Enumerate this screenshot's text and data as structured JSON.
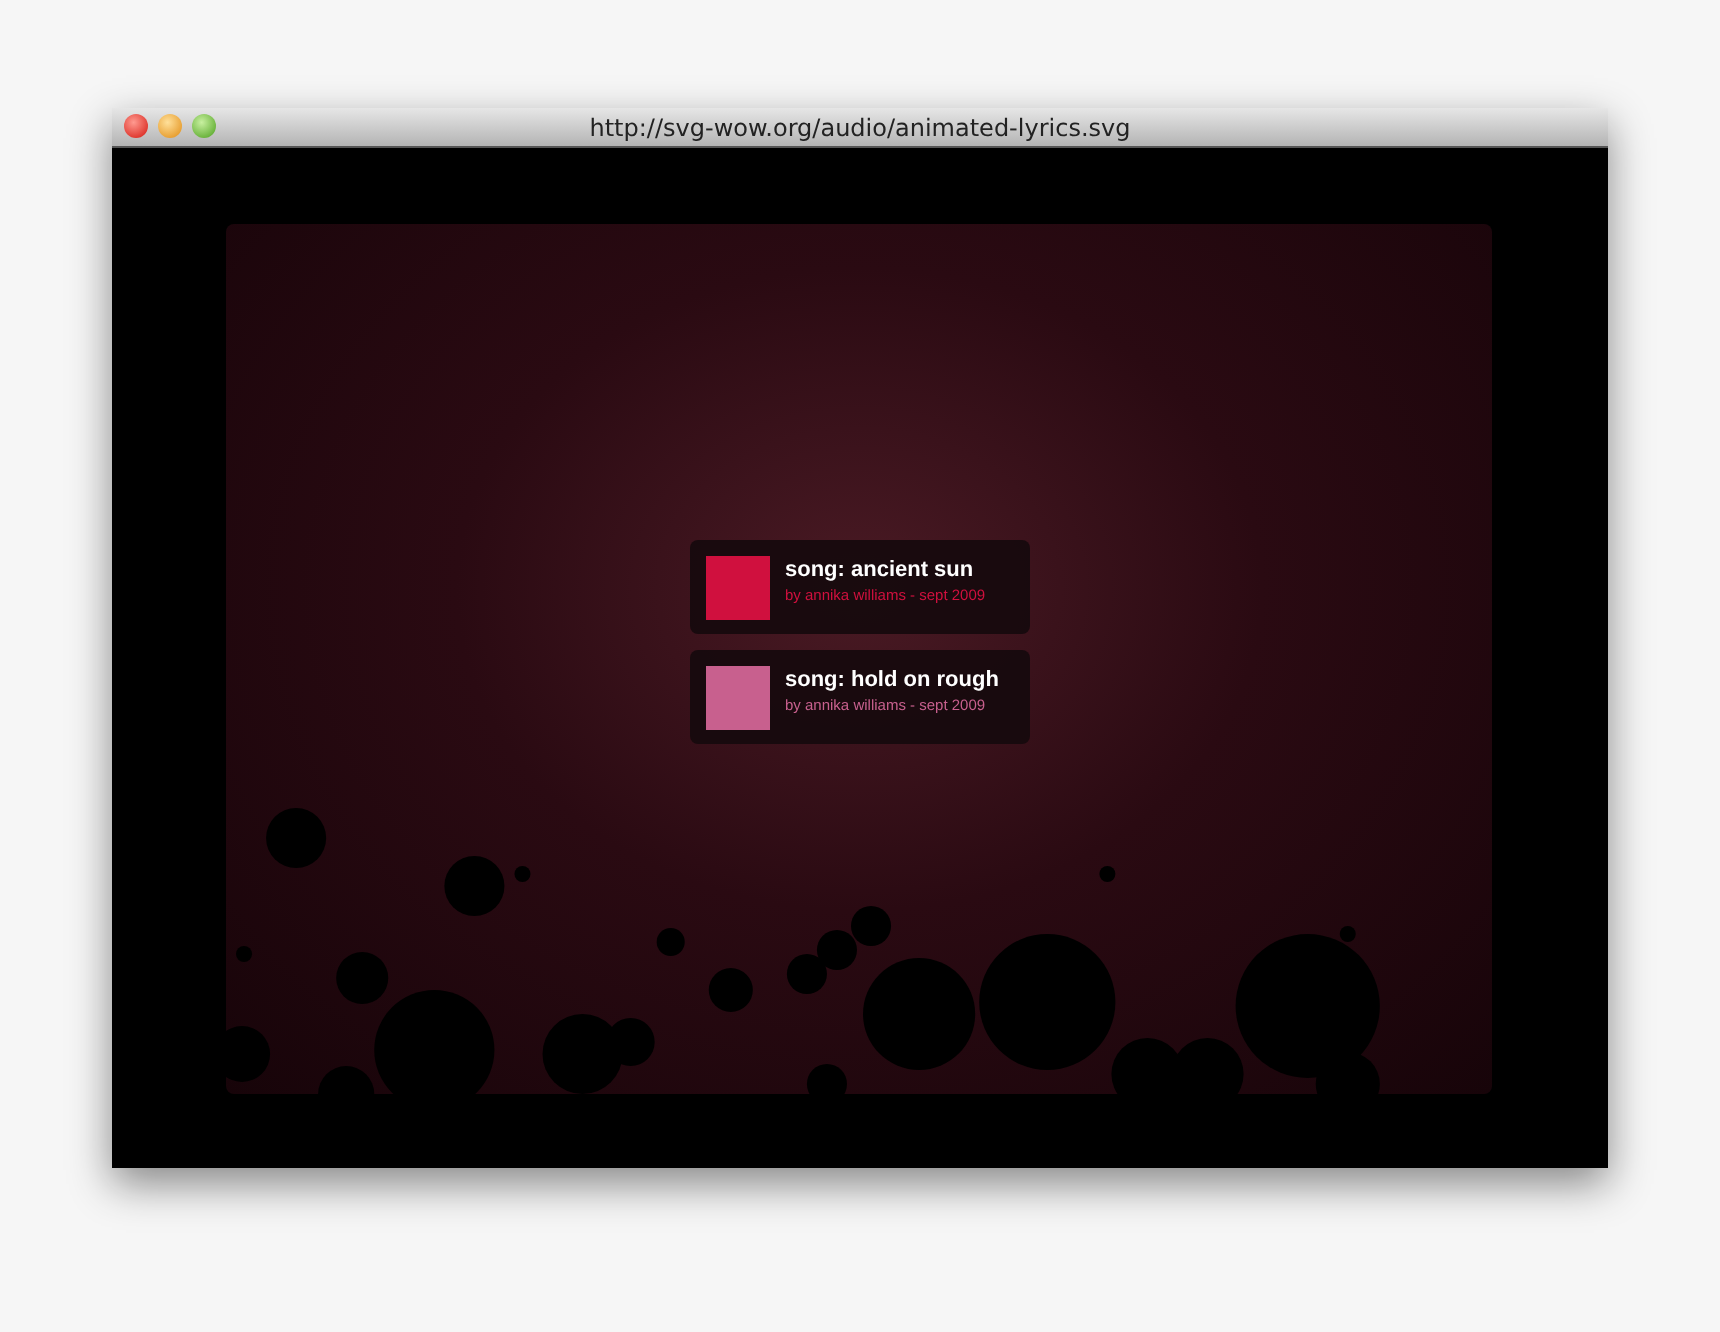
{
  "window": {
    "title": "http://svg-wow.org/audio/animated-lyrics.svg"
  },
  "songs": [
    {
      "title": "song: ancient sun",
      "byline": "by annika williams - sept 2009",
      "color": "#d0103e"
    },
    {
      "title": "song: hold on rough",
      "byline": "by annika williams - sept 2009",
      "color": "#c8608e"
    }
  ]
}
